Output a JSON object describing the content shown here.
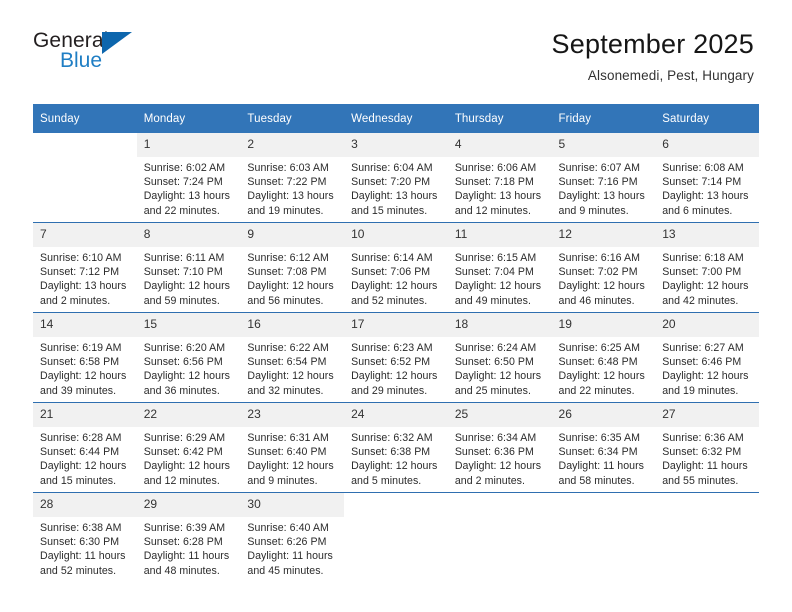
{
  "logo": {
    "word_one": "General",
    "word_two": "Blue",
    "triangle_icon": "blue-triangle-icon"
  },
  "header": {
    "title": "September 2025",
    "location": "Alsonemedi, Pest, Hungary"
  },
  "colors": {
    "header_blue": "#3275b8",
    "row_divider_blue": "#2f6fb0",
    "daynum_band": "#f1f1f1",
    "logo_blue": "#1f7ec4",
    "text": "#2b2b2b"
  },
  "calendar": {
    "weekday_headers": [
      "Sunday",
      "Monday",
      "Tuesday",
      "Wednesday",
      "Thursday",
      "Friday",
      "Saturday"
    ],
    "weeks": [
      [
        {
          "day": "",
          "sunrise": "",
          "sunset": "",
          "daylight_1": "",
          "daylight_2": ""
        },
        {
          "day": "1",
          "sunrise": "Sunrise: 6:02 AM",
          "sunset": "Sunset: 7:24 PM",
          "daylight_1": "Daylight: 13 hours",
          "daylight_2": "and 22 minutes."
        },
        {
          "day": "2",
          "sunrise": "Sunrise: 6:03 AM",
          "sunset": "Sunset: 7:22 PM",
          "daylight_1": "Daylight: 13 hours",
          "daylight_2": "and 19 minutes."
        },
        {
          "day": "3",
          "sunrise": "Sunrise: 6:04 AM",
          "sunset": "Sunset: 7:20 PM",
          "daylight_1": "Daylight: 13 hours",
          "daylight_2": "and 15 minutes."
        },
        {
          "day": "4",
          "sunrise": "Sunrise: 6:06 AM",
          "sunset": "Sunset: 7:18 PM",
          "daylight_1": "Daylight: 13 hours",
          "daylight_2": "and 12 minutes."
        },
        {
          "day": "5",
          "sunrise": "Sunrise: 6:07 AM",
          "sunset": "Sunset: 7:16 PM",
          "daylight_1": "Daylight: 13 hours",
          "daylight_2": "and 9 minutes."
        },
        {
          "day": "6",
          "sunrise": "Sunrise: 6:08 AM",
          "sunset": "Sunset: 7:14 PM",
          "daylight_1": "Daylight: 13 hours",
          "daylight_2": "and 6 minutes."
        }
      ],
      [
        {
          "day": "7",
          "sunrise": "Sunrise: 6:10 AM",
          "sunset": "Sunset: 7:12 PM",
          "daylight_1": "Daylight: 13 hours",
          "daylight_2": "and 2 minutes."
        },
        {
          "day": "8",
          "sunrise": "Sunrise: 6:11 AM",
          "sunset": "Sunset: 7:10 PM",
          "daylight_1": "Daylight: 12 hours",
          "daylight_2": "and 59 minutes."
        },
        {
          "day": "9",
          "sunrise": "Sunrise: 6:12 AM",
          "sunset": "Sunset: 7:08 PM",
          "daylight_1": "Daylight: 12 hours",
          "daylight_2": "and 56 minutes."
        },
        {
          "day": "10",
          "sunrise": "Sunrise: 6:14 AM",
          "sunset": "Sunset: 7:06 PM",
          "daylight_1": "Daylight: 12 hours",
          "daylight_2": "and 52 minutes."
        },
        {
          "day": "11",
          "sunrise": "Sunrise: 6:15 AM",
          "sunset": "Sunset: 7:04 PM",
          "daylight_1": "Daylight: 12 hours",
          "daylight_2": "and 49 minutes."
        },
        {
          "day": "12",
          "sunrise": "Sunrise: 6:16 AM",
          "sunset": "Sunset: 7:02 PM",
          "daylight_1": "Daylight: 12 hours",
          "daylight_2": "and 46 minutes."
        },
        {
          "day": "13",
          "sunrise": "Sunrise: 6:18 AM",
          "sunset": "Sunset: 7:00 PM",
          "daylight_1": "Daylight: 12 hours",
          "daylight_2": "and 42 minutes."
        }
      ],
      [
        {
          "day": "14",
          "sunrise": "Sunrise: 6:19 AM",
          "sunset": "Sunset: 6:58 PM",
          "daylight_1": "Daylight: 12 hours",
          "daylight_2": "and 39 minutes."
        },
        {
          "day": "15",
          "sunrise": "Sunrise: 6:20 AM",
          "sunset": "Sunset: 6:56 PM",
          "daylight_1": "Daylight: 12 hours",
          "daylight_2": "and 36 minutes."
        },
        {
          "day": "16",
          "sunrise": "Sunrise: 6:22 AM",
          "sunset": "Sunset: 6:54 PM",
          "daylight_1": "Daylight: 12 hours",
          "daylight_2": "and 32 minutes."
        },
        {
          "day": "17",
          "sunrise": "Sunrise: 6:23 AM",
          "sunset": "Sunset: 6:52 PM",
          "daylight_1": "Daylight: 12 hours",
          "daylight_2": "and 29 minutes."
        },
        {
          "day": "18",
          "sunrise": "Sunrise: 6:24 AM",
          "sunset": "Sunset: 6:50 PM",
          "daylight_1": "Daylight: 12 hours",
          "daylight_2": "and 25 minutes."
        },
        {
          "day": "19",
          "sunrise": "Sunrise: 6:25 AM",
          "sunset": "Sunset: 6:48 PM",
          "daylight_1": "Daylight: 12 hours",
          "daylight_2": "and 22 minutes."
        },
        {
          "day": "20",
          "sunrise": "Sunrise: 6:27 AM",
          "sunset": "Sunset: 6:46 PM",
          "daylight_1": "Daylight: 12 hours",
          "daylight_2": "and 19 minutes."
        }
      ],
      [
        {
          "day": "21",
          "sunrise": "Sunrise: 6:28 AM",
          "sunset": "Sunset: 6:44 PM",
          "daylight_1": "Daylight: 12 hours",
          "daylight_2": "and 15 minutes."
        },
        {
          "day": "22",
          "sunrise": "Sunrise: 6:29 AM",
          "sunset": "Sunset: 6:42 PM",
          "daylight_1": "Daylight: 12 hours",
          "daylight_2": "and 12 minutes."
        },
        {
          "day": "23",
          "sunrise": "Sunrise: 6:31 AM",
          "sunset": "Sunset: 6:40 PM",
          "daylight_1": "Daylight: 12 hours",
          "daylight_2": "and 9 minutes."
        },
        {
          "day": "24",
          "sunrise": "Sunrise: 6:32 AM",
          "sunset": "Sunset: 6:38 PM",
          "daylight_1": "Daylight: 12 hours",
          "daylight_2": "and 5 minutes."
        },
        {
          "day": "25",
          "sunrise": "Sunrise: 6:34 AM",
          "sunset": "Sunset: 6:36 PM",
          "daylight_1": "Daylight: 12 hours",
          "daylight_2": "and 2 minutes."
        },
        {
          "day": "26",
          "sunrise": "Sunrise: 6:35 AM",
          "sunset": "Sunset: 6:34 PM",
          "daylight_1": "Daylight: 11 hours",
          "daylight_2": "and 58 minutes."
        },
        {
          "day": "27",
          "sunrise": "Sunrise: 6:36 AM",
          "sunset": "Sunset: 6:32 PM",
          "daylight_1": "Daylight: 11 hours",
          "daylight_2": "and 55 minutes."
        }
      ],
      [
        {
          "day": "28",
          "sunrise": "Sunrise: 6:38 AM",
          "sunset": "Sunset: 6:30 PM",
          "daylight_1": "Daylight: 11 hours",
          "daylight_2": "and 52 minutes."
        },
        {
          "day": "29",
          "sunrise": "Sunrise: 6:39 AM",
          "sunset": "Sunset: 6:28 PM",
          "daylight_1": "Daylight: 11 hours",
          "daylight_2": "and 48 minutes."
        },
        {
          "day": "30",
          "sunrise": "Sunrise: 6:40 AM",
          "sunset": "Sunset: 6:26 PM",
          "daylight_1": "Daylight: 11 hours",
          "daylight_2": "and 45 minutes."
        },
        {
          "day": "",
          "sunrise": "",
          "sunset": "",
          "daylight_1": "",
          "daylight_2": ""
        },
        {
          "day": "",
          "sunrise": "",
          "sunset": "",
          "daylight_1": "",
          "daylight_2": ""
        },
        {
          "day": "",
          "sunrise": "",
          "sunset": "",
          "daylight_1": "",
          "daylight_2": ""
        },
        {
          "day": "",
          "sunrise": "",
          "sunset": "",
          "daylight_1": "",
          "daylight_2": ""
        }
      ]
    ]
  }
}
